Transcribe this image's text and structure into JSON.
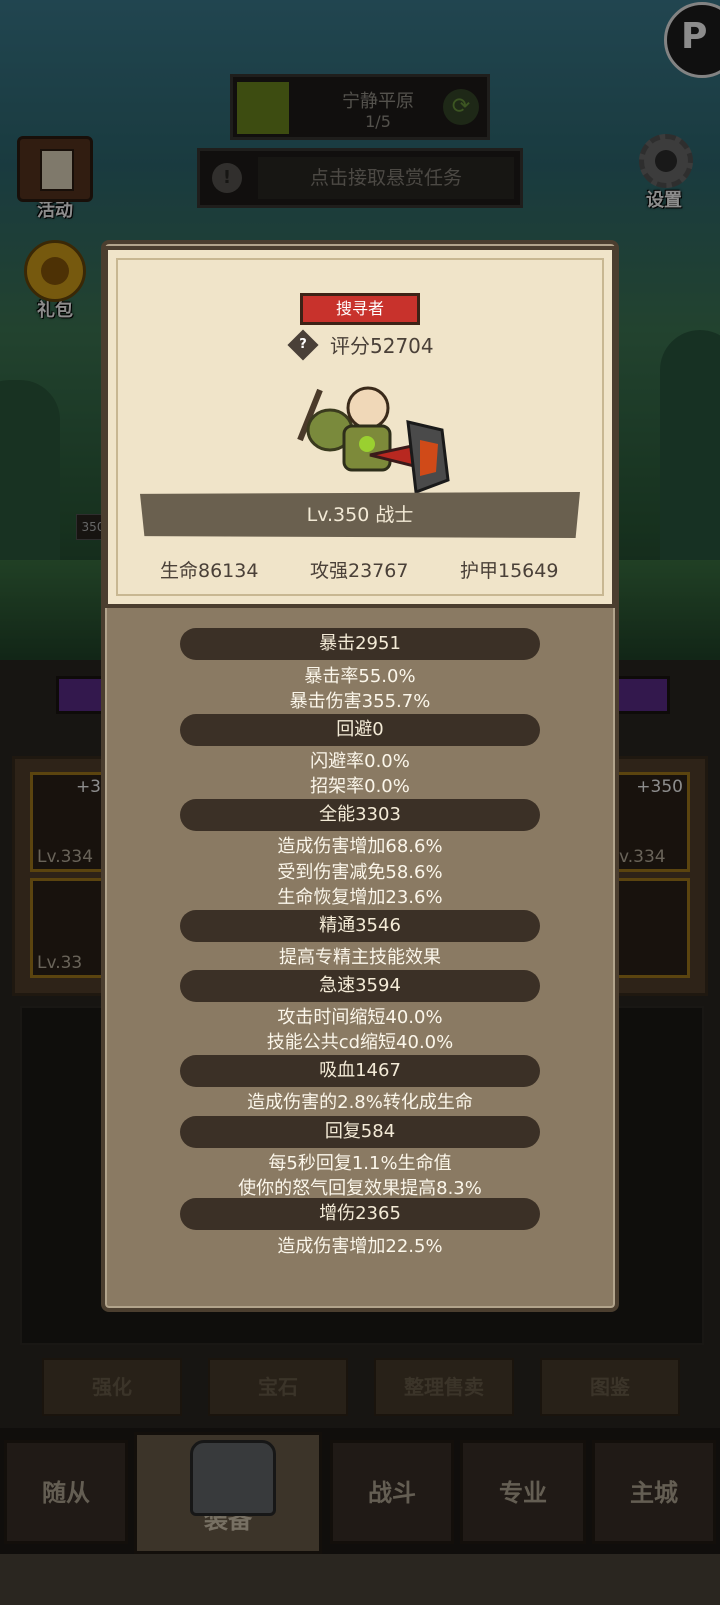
{
  "hud": {
    "stage_name": "宁静平原",
    "stage_progress": "1/5",
    "quest_text": "点击接取悬赏任务",
    "activity_label": "活动",
    "gift_label": "礼包",
    "settings_label": "设置",
    "mini_level": "350"
  },
  "equipment": {
    "slots": [
      {
        "plus": "+3",
        "level": "Lv.334"
      },
      {
        "plus": "",
        "level": "Lv.33"
      },
      {
        "plus": "+350",
        "level": "v.334"
      }
    ]
  },
  "actions": {
    "enhance": "强化",
    "gem": "宝石",
    "sort_sell": "整理售卖",
    "codex": "图鉴"
  },
  "nav": {
    "followers": "随从",
    "equipment": "装备",
    "battle": "战斗",
    "profession": "专业",
    "main_city": "主城"
  },
  "character": {
    "role": "搜寻者",
    "score_icon": "?",
    "score": "评分52704",
    "level_class": "Lv.350 战士",
    "hp": "生命86134",
    "attack": "攻强23767",
    "armor": "护甲15649"
  },
  "stats": [
    {
      "title": "暴击2951",
      "lines": [
        "暴击率55.0%",
        "暴击伤害355.7%"
      ]
    },
    {
      "title": "回避0",
      "lines": [
        "闪避率0.0%",
        "招架率0.0%"
      ]
    },
    {
      "title": "全能3303",
      "lines": [
        "造成伤害增加68.6%",
        "受到伤害减免58.6%",
        "生命恢复增加23.6%"
      ]
    },
    {
      "title": "精通3546",
      "lines": [
        "提高专精主技能效果"
      ]
    },
    {
      "title": "急速3594",
      "lines": [
        "攻击时间缩短40.0%",
        "技能公共cd缩短40.0%"
      ]
    },
    {
      "title": "吸血1467",
      "lines": [
        "造成伤害的2.8%转化成生命"
      ]
    },
    {
      "title": "回复584",
      "lines": [
        "每5秒回复1.1%生命值",
        "使你的怒气回复效果提高8.3%"
      ]
    },
    {
      "title": "增伤2365",
      "lines": [
        "造成伤害增加22.5%"
      ]
    }
  ],
  "colors": {
    "panel_bg": "#8a7a63",
    "card_bg": "#f0e4c9",
    "stat_bar": "#3b3026",
    "role_badge": "#c8322c"
  }
}
